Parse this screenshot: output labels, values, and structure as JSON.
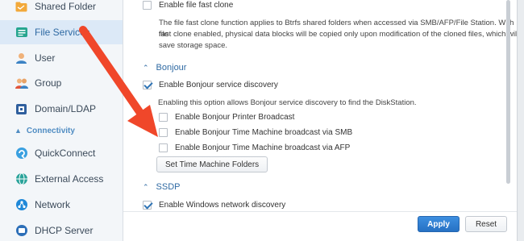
{
  "sidebar": {
    "items": [
      {
        "label": "Shared Folder",
        "icon": "folder-icon",
        "active": false
      },
      {
        "label": "File Services",
        "icon": "file-services-icon",
        "active": true
      },
      {
        "label": "User",
        "icon": "user-icon",
        "active": false
      },
      {
        "label": "Group",
        "icon": "group-icon",
        "active": false
      },
      {
        "label": "Domain/LDAP",
        "icon": "domain-icon",
        "active": false
      }
    ],
    "group_label": "Connectivity",
    "group_items": [
      {
        "label": "QuickConnect",
        "icon": "quickconnect-icon"
      },
      {
        "label": "External Access",
        "icon": "external-access-icon"
      },
      {
        "label": "Network",
        "icon": "network-icon"
      },
      {
        "label": "DHCP Server",
        "icon": "dhcp-icon"
      }
    ]
  },
  "content": {
    "fast_clone": {
      "label": "Enable file fast clone",
      "checked": false,
      "description_line1": "The file fast clone function applies to Btrfs shared folders when accessed via SMB/AFP/File Station. With file",
      "description_line2": "fast clone enabled, physical data blocks will be copied only upon modification of the cloned files, which will",
      "description_line3": "save storage space."
    },
    "bonjour": {
      "title": "Bonjour",
      "discovery_label": "Enable Bonjour service discovery",
      "discovery_checked": true,
      "discovery_description": "Enabling this option allows Bonjour service discovery to find the DiskStation.",
      "printer_label": "Enable Bonjour Printer Broadcast",
      "smb_label": "Enable Bonjour Time Machine broadcast via SMB",
      "afp_label": "Enable Bonjour Time Machine broadcast via AFP",
      "folders_button": "Set Time Machine Folders"
    },
    "ssdp": {
      "title": "SSDP",
      "windows_discovery_label": "Enable Windows network discovery",
      "windows_discovery_checked": true
    }
  },
  "footer": {
    "apply_label": "Apply",
    "reset_label": "Reset"
  },
  "colors": {
    "accent": "#2f6aa3",
    "apply_button": "#2f7bd0",
    "arrow": "#f0472a",
    "active_sidebar": "#dce9f7"
  }
}
